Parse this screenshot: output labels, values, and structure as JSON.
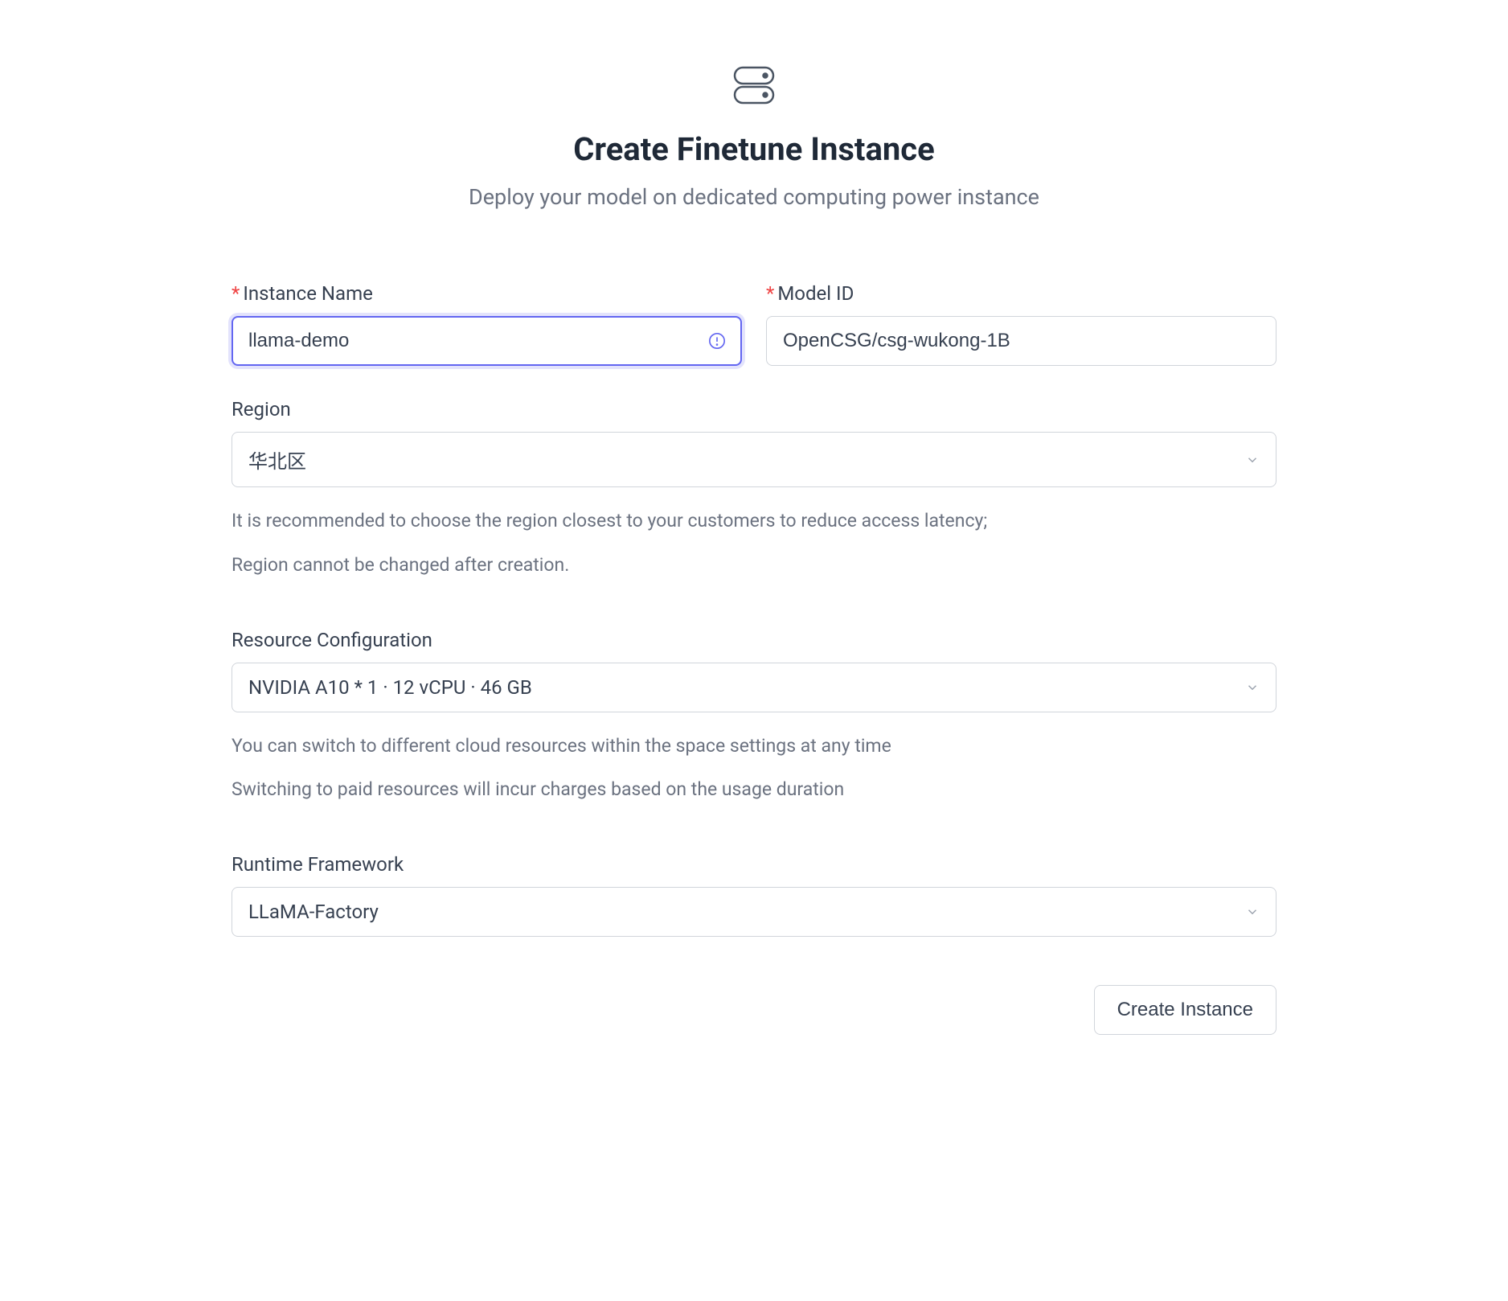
{
  "header": {
    "title": "Create Finetune Instance",
    "subtitle": "Deploy your model on dedicated computing power instance"
  },
  "form": {
    "instance_name": {
      "label": "Instance Name",
      "value": "llama-demo"
    },
    "model_id": {
      "label": "Model ID",
      "value": "OpenCSG/csg-wukong-1B"
    },
    "region": {
      "label": "Region",
      "value": "华北区",
      "help_line1": "It is recommended to choose the region closest to your customers to reduce access latency;",
      "help_line2": "Region cannot be changed after creation."
    },
    "resource": {
      "label": "Resource Configuration",
      "value": "NVIDIA A10 * 1 · 12 vCPU · 46 GB",
      "help_line1": "You can switch to different cloud resources within the space settings at any time",
      "help_line2": "Switching to paid resources will incur charges based on the usage duration"
    },
    "runtime": {
      "label": "Runtime Framework",
      "value": "LLaMA-Factory"
    },
    "submit_label": "Create Instance"
  }
}
